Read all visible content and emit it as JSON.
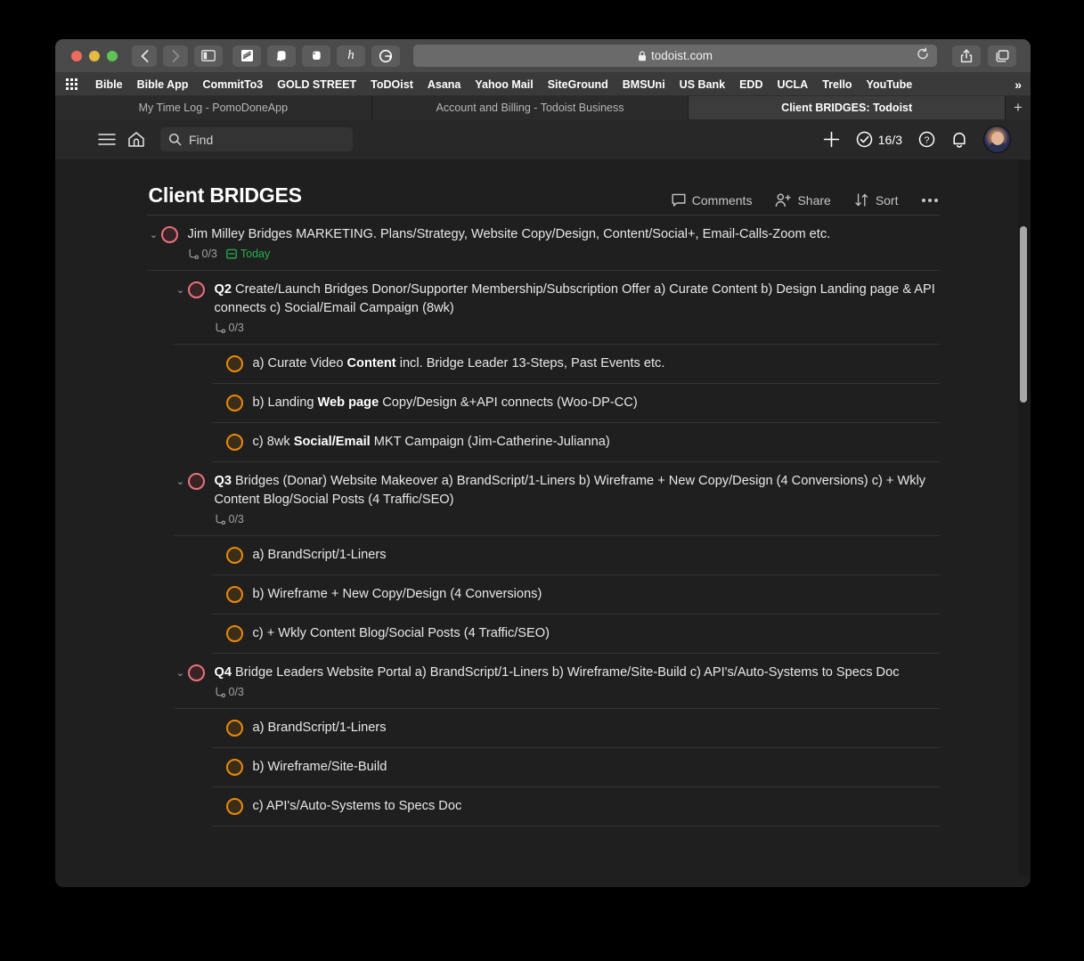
{
  "browser": {
    "url": "todoist.com",
    "lock_icon": "lock-icon",
    "reload_icon": "reload-icon",
    "back_icon": "chevron-left-icon",
    "forward_icon": "chevron-right-icon",
    "sidebar_icon": "sidebar-icon",
    "extensions": [
      "stacked-papers-icon",
      "evernote-clipper-icon",
      "evernote-icon",
      "hypothesis-icon",
      "grammarly-icon"
    ],
    "share_icon": "share-icon",
    "tabs_overview_icon": "tab-overview-icon",
    "bookmarks": [
      "Bible",
      "Bible App",
      "CommitTo3",
      "GOLD STREET",
      "ToDOist",
      "Asana",
      "Yahoo Mail",
      "SiteGround",
      "BMSUni",
      "US Bank",
      "EDD",
      "UCLA",
      "Trello",
      "YouTube"
    ],
    "bookmarks_overflow": "»",
    "tabs": [
      {
        "title": "My Time Log - PomoDoneApp",
        "active": false
      },
      {
        "title": "Account and Billing - Todoist Business",
        "active": false
      },
      {
        "title": "Client BRIDGES: Todoist",
        "active": true
      }
    ],
    "new_tab_label": "+"
  },
  "app_header": {
    "menu_icon": "hamburger-menu-icon",
    "home_icon": "home-icon",
    "search": {
      "placeholder": "Find",
      "value": ""
    },
    "add_label": "+",
    "karma_count": "16/3",
    "help_label": "?",
    "notifications_icon": "bell-icon",
    "avatar_name": "user-avatar"
  },
  "project": {
    "title": "Client BRIDGES",
    "actions": [
      {
        "label": "Comments",
        "icon": "comment-icon"
      },
      {
        "label": "Share",
        "icon": "share-person-icon"
      },
      {
        "label": "Sort",
        "icon": "sort-arrows-icon"
      }
    ],
    "more_label": "•••"
  },
  "tasks": [
    {
      "level": 0,
      "chevron": "⌄",
      "priority": "p1",
      "prefix": "",
      "text": "Jim Milley Bridges MARKETING. Plans/Strategy, Website Copy/Design, Content/Social+, Email-Calls-Zoom etc.",
      "subtask_count": "0/3",
      "due": "Today"
    },
    {
      "level": 1,
      "chevron": "⌄",
      "priority": "p1",
      "prefix": "Q2",
      "text": " Create/Launch Bridges Donor/Supporter Membership/Subscription Offer a) Curate Content b) Design Landing page & API connects c) Social/Email Campaign (8wk)",
      "subtask_count": "0/3",
      "due": ""
    },
    {
      "level": 2,
      "chevron": "",
      "priority": "p2",
      "prefix": "",
      "text_before": "a) Curate Video ",
      "text_bold": "Content",
      "text_after": " incl. Bridge Leader 13-Steps, Past Events etc.",
      "text": "a) Curate Video Content incl. Bridge Leader 13-Steps, Past Events etc.",
      "subtask_count": "",
      "due": ""
    },
    {
      "level": 2,
      "chevron": "",
      "priority": "p2",
      "prefix": "",
      "text_before": "b) Landing ",
      "text_bold": "Web page",
      "text_after": " Copy/Design &+API connects (Woo-DP-CC)",
      "text": "b) Landing Web page Copy/Design &+API connects (Woo-DP-CC)",
      "subtask_count": "",
      "due": ""
    },
    {
      "level": 2,
      "chevron": "",
      "priority": "p2",
      "prefix": "",
      "text_before": "c) 8wk ",
      "text_bold": "Social/Email",
      "text_after": " MKT Campaign (Jim-Catherine-Julianna)",
      "text": "c) 8wk Social/Email MKT Campaign (Jim-Catherine-Julianna)",
      "subtask_count": "",
      "due": ""
    },
    {
      "level": 1,
      "chevron": "⌄",
      "priority": "p1",
      "prefix": "Q3",
      "text": " Bridges (Donar) Website Makeover a) BrandScript/1-Liners b) Wireframe + New Copy/Design (4 Conversions) c) + Wkly Content Blog/Social Posts (4 Traffic/SEO)",
      "subtask_count": "0/3",
      "due": ""
    },
    {
      "level": 2,
      "chevron": "",
      "priority": "p2",
      "prefix": "",
      "text": "a) BrandScript/1-Liners",
      "subtask_count": "",
      "due": ""
    },
    {
      "level": 2,
      "chevron": "",
      "priority": "p2",
      "prefix": "",
      "text": "b) Wireframe + New Copy/Design (4 Conversions)",
      "subtask_count": "",
      "due": ""
    },
    {
      "level": 2,
      "chevron": "",
      "priority": "p2",
      "prefix": "",
      "text": "c) + Wkly Content Blog/Social Posts (4 Traffic/SEO)",
      "subtask_count": "",
      "due": ""
    },
    {
      "level": 1,
      "chevron": "⌄",
      "priority": "p1",
      "prefix": "Q4",
      "text": " Bridge Leaders Website Portal a) BrandScript/1-Liners b) Wireframe/Site-Build c) API's/Auto-Systems to Specs Doc",
      "subtask_count": "0/3",
      "due": ""
    },
    {
      "level": 2,
      "chevron": "",
      "priority": "p2",
      "prefix": "",
      "text": "a) BrandScript/1-Liners",
      "subtask_count": "",
      "due": ""
    },
    {
      "level": 2,
      "chevron": "",
      "priority": "p2",
      "prefix": "",
      "text": "b) Wireframe/Site-Build",
      "subtask_count": "",
      "due": ""
    },
    {
      "level": 2,
      "chevron": "",
      "priority": "p2",
      "prefix": "",
      "text": "c) API's/Auto-Systems to Specs Doc",
      "subtask_count": "",
      "due": ""
    }
  ],
  "colors": {
    "priority1": "#e8737d",
    "priority2": "#eb8909",
    "due_today": "#25b14c",
    "background": "#1f1f1f"
  }
}
